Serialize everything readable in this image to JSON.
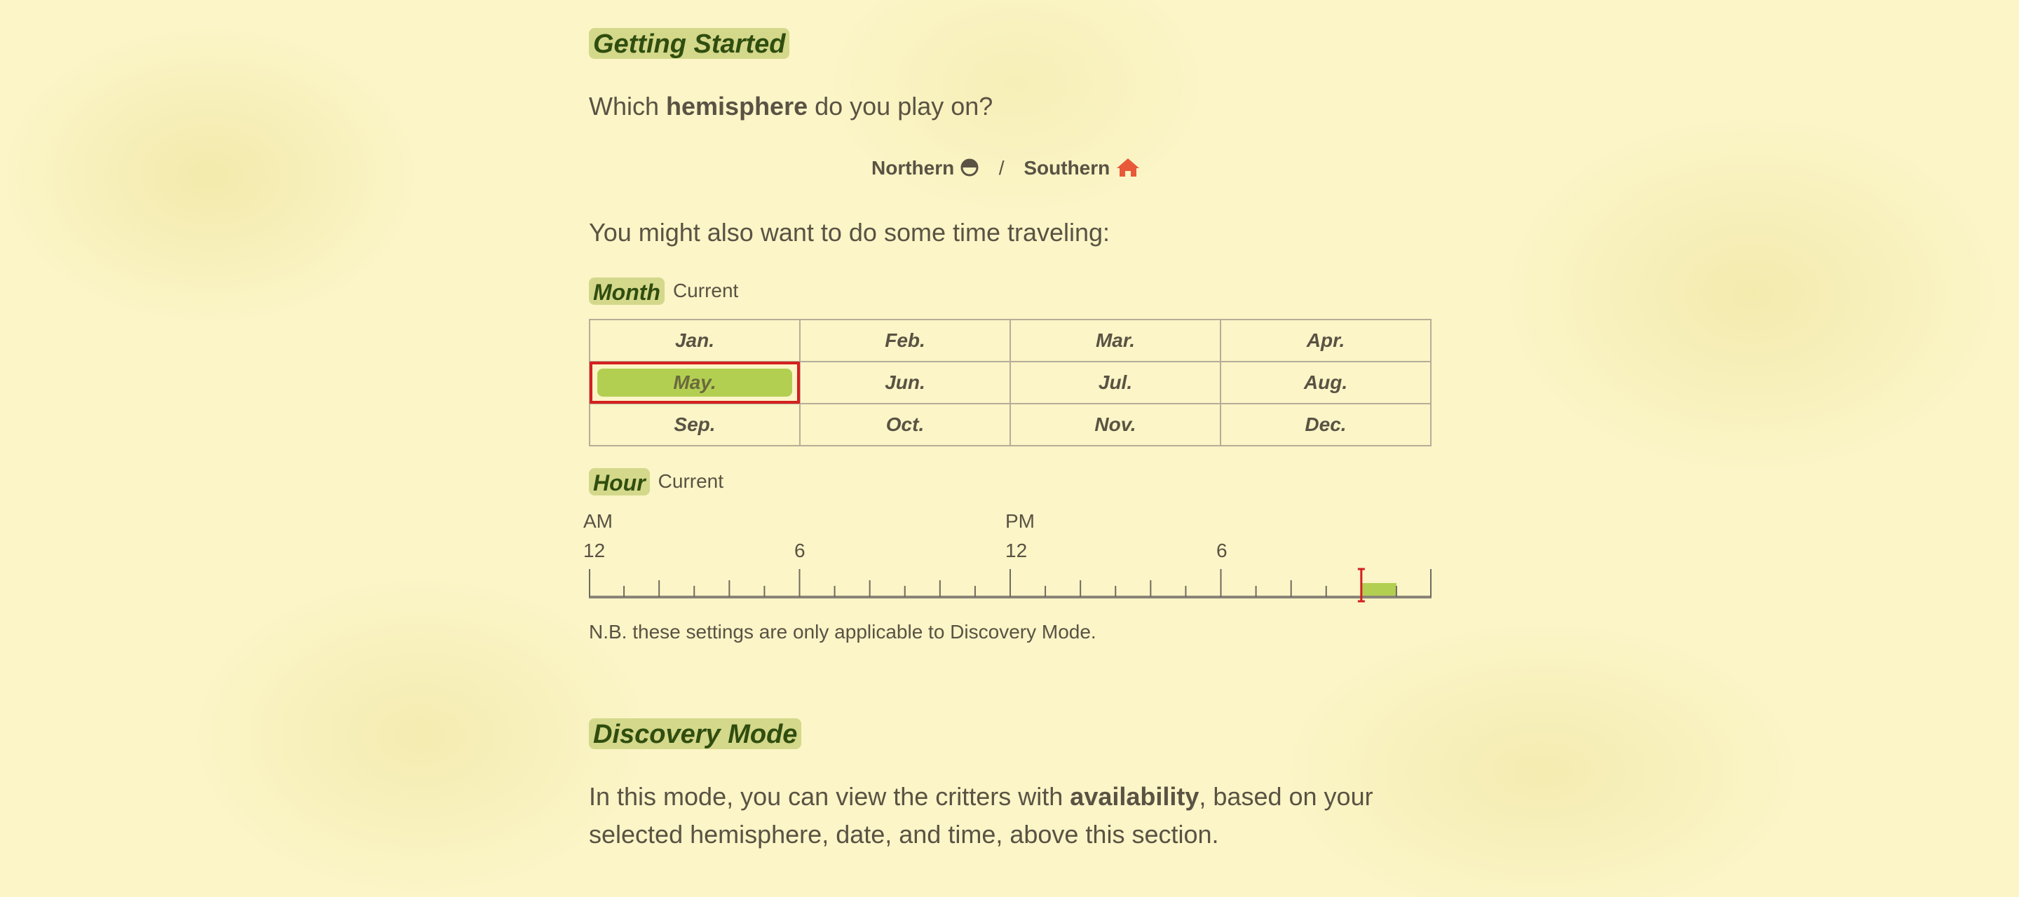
{
  "getting_started": {
    "heading": "Getting Started",
    "question_pre": "Which ",
    "question_bold": "hemisphere",
    "question_post": " do you play on?",
    "northern": "Northern",
    "separator": "/",
    "southern": "Southern",
    "time_travel": "You might also want to do some time traveling:"
  },
  "month": {
    "label": "Month",
    "current": "Current",
    "rows": [
      [
        "Jan.",
        "Feb.",
        "Mar.",
        "Apr."
      ],
      [
        "May.",
        "Jun.",
        "Jul.",
        "Aug."
      ],
      [
        "Sep.",
        "Oct.",
        "Nov.",
        "Dec."
      ]
    ],
    "selected": "May."
  },
  "hour": {
    "label": "Hour",
    "current": "Current",
    "am": "AM",
    "pm": "PM",
    "ticks": [
      "12",
      "6",
      "12",
      "6"
    ],
    "selected_hour": 22,
    "highlight_color": "#b3cf52",
    "cursor_color": "#d52020"
  },
  "note": "N.B. these settings are only applicable to Discovery Mode.",
  "discovery": {
    "heading": "Discovery Mode",
    "line1_pre": "In this mode, you can view the critters with ",
    "line1_bold": "availability",
    "line1_post": ", based on your",
    "line2": "selected hemisphere, date, and time, above this section."
  },
  "icons": {
    "northern": "half-circle-icon",
    "southern": "house-icon"
  },
  "colors": {
    "tag_bg": "#d4d88a",
    "tag_text": "#2f4d0f",
    "southern_icon": "#e8593a",
    "selection_outline": "#d52020"
  }
}
